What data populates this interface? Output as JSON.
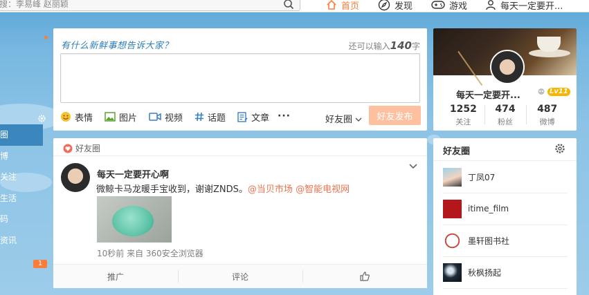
{
  "topbar": {
    "search_placeholder": "搜：李易峰 赵丽颖",
    "nav": [
      {
        "label": "首页",
        "icon": "home-icon"
      },
      {
        "label": "发现",
        "icon": "compass-icon"
      },
      {
        "label": "游戏",
        "icon": "gamepad-icon"
      },
      {
        "label": "每天一定要开...",
        "icon": "user-icon"
      }
    ]
  },
  "sidebar": {
    "items": [
      "圈",
      "博",
      "关注",
      "生活",
      "码",
      "资讯"
    ],
    "badge": "1"
  },
  "composer": {
    "prompt": "有什么新鲜事想告诉大家？",
    "limit_prefix": "还可以输入",
    "limit_number": "140",
    "limit_suffix": "字",
    "tools": [
      {
        "label": "表情",
        "icon": "emoji-icon"
      },
      {
        "label": "图片",
        "icon": "image-icon"
      },
      {
        "label": "视频",
        "icon": "video-icon"
      },
      {
        "label": "话题",
        "icon": "hashtag-icon"
      },
      {
        "label": "文章",
        "icon": "article-icon"
      }
    ],
    "more": "···",
    "visibility": "好友圈",
    "publish_label": "好友发布"
  },
  "feed": {
    "header": "好友圈",
    "post": {
      "author": "每天一定要开心啊",
      "text": "微鲸卡马龙暖手宝收到，谢谢ZNDS。",
      "mentions": [
        "@当贝市场",
        "@智能电视网"
      ],
      "meta": "10秒前 来自 360安全浏览器"
    },
    "actions": {
      "repost": "推广",
      "comment": "评论"
    }
  },
  "profile": {
    "name": "每天一定要开...",
    "level": "Lv11",
    "stats": [
      {
        "value": "1252",
        "label": "关注"
      },
      {
        "value": "474",
        "label": "粉丝"
      },
      {
        "value": "487",
        "label": "微博"
      }
    ]
  },
  "friends_circle": {
    "title": "好友圈",
    "members": [
      "丁凤07",
      "itime_film",
      "墨轩图书社",
      "秋枫扬起"
    ]
  },
  "colors": {
    "accent": "#fa7d3c",
    "link": "#eb7350",
    "prompt": "#2d7dbb",
    "publish_disabled": "#ffc09f"
  }
}
